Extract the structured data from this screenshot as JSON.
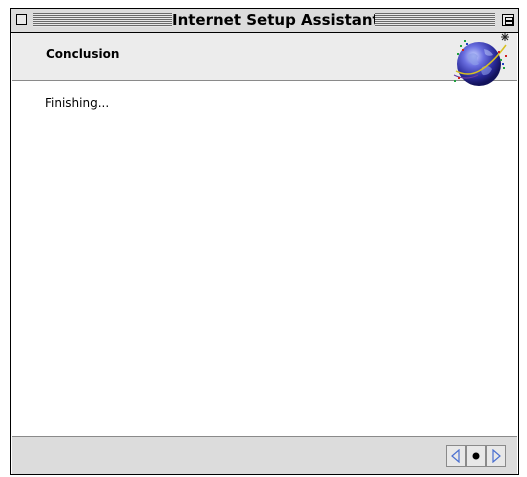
{
  "window": {
    "title": "Internet Setup Assistant"
  },
  "header": {
    "section_title": "Conclusion"
  },
  "content": {
    "status_text": "Finishing..."
  },
  "icons": {
    "close": "close-box-icon",
    "zoom": "zoom-box-icon",
    "globe": "globe-icon",
    "back": "triangle-left-icon",
    "home": "dot-icon",
    "forward": "triangle-right-icon"
  },
  "colors": {
    "titlebar_bg": "#dcdcdc",
    "header_bg": "#ececec",
    "footer_bg": "#dcdcdc",
    "nav_arrow": "#4a6fd0"
  }
}
